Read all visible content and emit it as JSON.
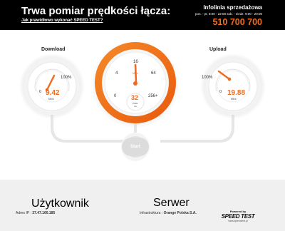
{
  "header": {
    "title": "Trwa pomiar prędkości łącza:",
    "help_link": "Jak prawidłowo wykonać SPEED TEST?",
    "hotline_label": "Infolinia sprzedażowa",
    "hotline_hours": "pon. - pt. 8:00 - 22:00 sob. - niedz. 9:00 - 20:00",
    "hotline_phone": "510 700 700"
  },
  "download": {
    "label": "Download",
    "scale_min": "0",
    "scale_max": "100%",
    "value": "9.42",
    "unit": "Mb/s",
    "level_fraction": 0.094
  },
  "speed": {
    "ticks": [
      "0",
      "4",
      "16",
      "64",
      "256+"
    ],
    "unit": "Mb/s",
    "ping_value": "32",
    "ping_label": "PING",
    "ping_unit": "ms"
  },
  "upload": {
    "label": "Upload",
    "scale_min": "0",
    "scale_max": "100%",
    "value": "19.88",
    "unit": "Mb/s",
    "level_fraction": 0.199
  },
  "start_button": "Start",
  "footer": {
    "user_title": "Użytkownik",
    "ip_label": "Adres IP :",
    "ip_value": "37.47.160.185",
    "server_title": "Serwer",
    "infra_label": "Infrastruktura :",
    "infra_value": "Orange Polska S.A.",
    "powered_by": "Powered by",
    "brand": "SPEED TEST",
    "brand_url": "www.speedtest.pl"
  },
  "colors": {
    "accent": "#f26b1d",
    "header_bg": "#000000",
    "footer_bg": "#f0f0f0"
  }
}
